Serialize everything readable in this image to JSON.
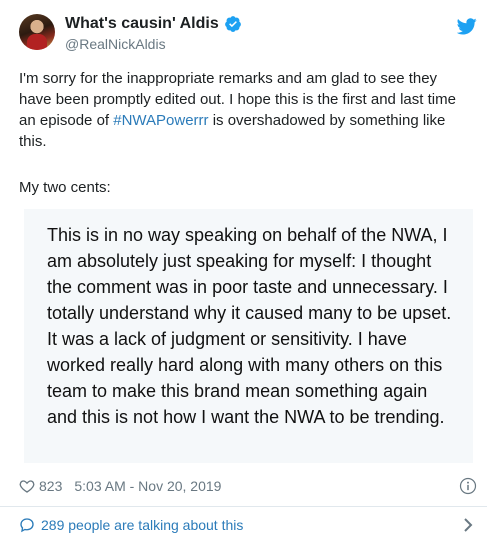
{
  "author": {
    "display_name": "What's causin' Aldis",
    "handle": "@RealNickAldis",
    "verified": true
  },
  "tweet": {
    "text_before": "I'm sorry for the inappropriate remarks and am glad to see they have been promptly edited out. I hope this is the first and last time an episode of ",
    "hashtag": "#NWAPowerrr",
    "text_after": " is overshadowed by something like this.",
    "cents": "My two cents:",
    "quote": "This is in no way speaking on behalf of the NWA, I am absolutely just speaking for myself: I thought the comment was in poor taste and unnecessary. I totally understand why it caused many to be upset. It was a lack of judgment or sensitivity. I have worked really hard along with many others on this team to make this brand mean something again and this is not how I want the NWA to be trending."
  },
  "meta": {
    "likes": "823",
    "timestamp": "5:03 AM - Nov 20, 2019"
  },
  "footer": {
    "talking": "289 people are talking about this"
  },
  "colors": {
    "link": "#2b7bb9",
    "twitter_blue": "#1da1f2",
    "muted": "#697882"
  },
  "icons": [
    "verified-icon",
    "twitter-bird-icon",
    "heart-icon",
    "info-icon",
    "speech-bubble-icon",
    "chevron-right-icon"
  ]
}
